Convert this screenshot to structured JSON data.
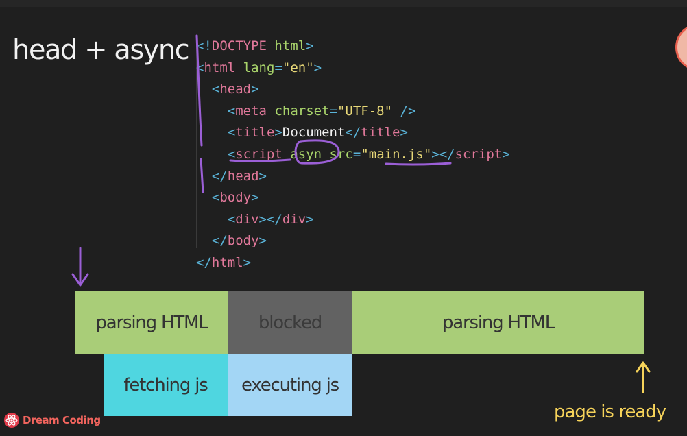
{
  "slide": {
    "title": "head + async"
  },
  "code": {
    "lines": [
      {
        "indent": "",
        "parts": [
          [
            "punc",
            "<!"
          ],
          [
            "tag",
            "DOCTYPE"
          ],
          [
            "plain",
            " "
          ],
          [
            "attr",
            "html"
          ],
          [
            "punc",
            ">"
          ]
        ]
      },
      {
        "indent": "",
        "parts": [
          [
            "punc",
            "<"
          ],
          [
            "tag",
            "html"
          ],
          [
            "plain",
            " "
          ],
          [
            "attr",
            "lang"
          ],
          [
            "punc",
            "="
          ],
          [
            "str",
            "\"en\""
          ],
          [
            "punc",
            ">"
          ]
        ]
      },
      {
        "indent": "  ",
        "parts": [
          [
            "punc",
            "<"
          ],
          [
            "tag",
            "head"
          ],
          [
            "punc",
            ">"
          ]
        ]
      },
      {
        "indent": "    ",
        "parts": [
          [
            "punc",
            "<"
          ],
          [
            "tag",
            "meta"
          ],
          [
            "plain",
            " "
          ],
          [
            "attr",
            "charset"
          ],
          [
            "punc",
            "="
          ],
          [
            "str",
            "\"UTF-8\""
          ],
          [
            "plain",
            " "
          ],
          [
            "punc",
            "/>"
          ]
        ]
      },
      {
        "indent": "    ",
        "parts": [
          [
            "punc",
            "<"
          ],
          [
            "tag",
            "title"
          ],
          [
            "punc",
            ">"
          ],
          [
            "plain",
            "Document"
          ],
          [
            "punc",
            "</"
          ],
          [
            "tag",
            "title"
          ],
          [
            "punc",
            ">"
          ]
        ]
      },
      {
        "indent": "    ",
        "parts": [
          [
            "punc",
            "<"
          ],
          [
            "tag",
            "script"
          ],
          [
            "plain",
            " "
          ],
          [
            "attr",
            "asyn"
          ],
          [
            "plain",
            " "
          ],
          [
            "attr",
            "src"
          ],
          [
            "punc",
            "="
          ],
          [
            "str",
            "\"main.js\""
          ],
          [
            "punc",
            "></"
          ],
          [
            "tag",
            "script"
          ],
          [
            "punc",
            ">"
          ]
        ]
      },
      {
        "indent": "  ",
        "parts": [
          [
            "punc",
            "</"
          ],
          [
            "tag",
            "head"
          ],
          [
            "punc",
            ">"
          ]
        ]
      },
      {
        "indent": "  ",
        "parts": [
          [
            "punc",
            "<"
          ],
          [
            "tag",
            "body"
          ],
          [
            "punc",
            ">"
          ]
        ]
      },
      {
        "indent": "    ",
        "parts": [
          [
            "punc",
            "<"
          ],
          [
            "tag",
            "div"
          ],
          [
            "punc",
            "></"
          ],
          [
            "tag",
            "div"
          ],
          [
            "punc",
            ">"
          ]
        ]
      },
      {
        "indent": "  ",
        "parts": [
          [
            "punc",
            "</"
          ],
          [
            "tag",
            "body"
          ],
          [
            "punc",
            ">"
          ]
        ]
      },
      {
        "indent": "",
        "parts": [
          [
            "punc",
            "</"
          ],
          [
            "tag",
            "html"
          ],
          [
            "punc",
            ">"
          ]
        ]
      }
    ]
  },
  "timeline": {
    "main_track": [
      {
        "label": "parsing HTML",
        "kind": "parsing"
      },
      {
        "label": "blocked",
        "kind": "blocked"
      },
      {
        "label": "parsing HTML",
        "kind": "parsing"
      }
    ],
    "sub_track": [
      {
        "label": "fetching js",
        "kind": "fetching"
      },
      {
        "label": "executing js",
        "kind": "executing"
      }
    ],
    "ready_label": "page is ready"
  },
  "colors": {
    "parsing": "#a9cd78",
    "blocked": "#626262",
    "fetching": "#4fd6e0",
    "executing": "#a3d6f5",
    "ready": "#f6d35a",
    "annotation": "#9b5fd6"
  },
  "brand": {
    "name": "Dream Coding",
    "icon": "react-atom-icon"
  }
}
